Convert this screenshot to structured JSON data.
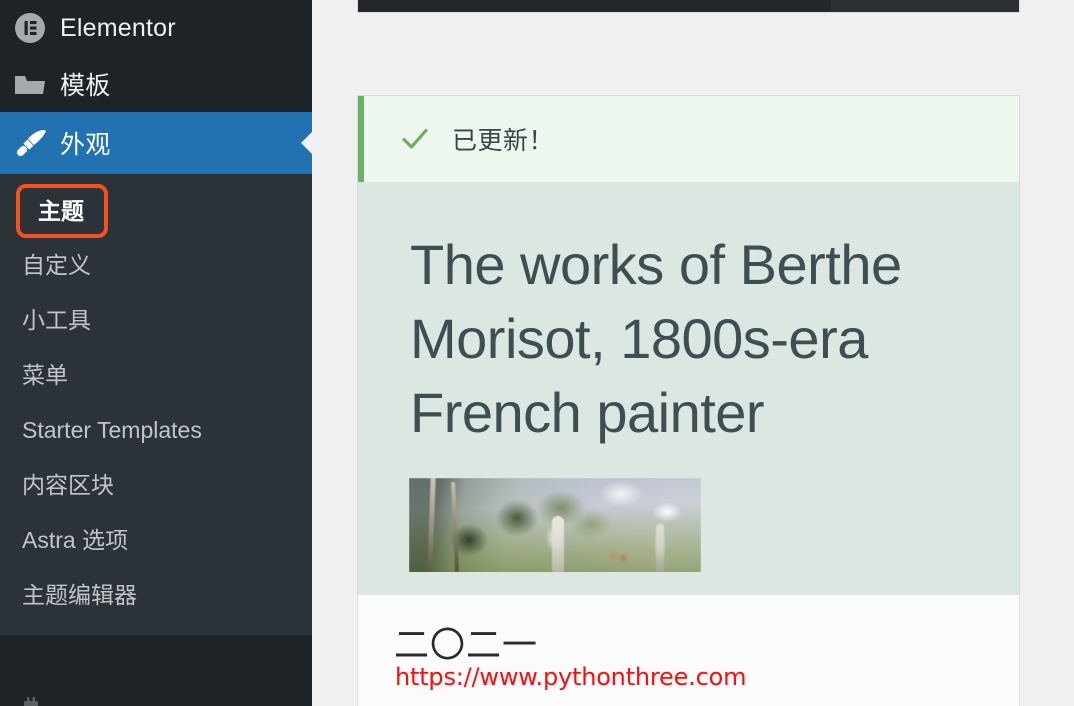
{
  "sidebar": {
    "top_items": [
      {
        "label": "Elementor",
        "icon": "elementor-icon",
        "current": false
      },
      {
        "label": "模板",
        "icon": "folder-icon",
        "current": false
      },
      {
        "label": "外观",
        "icon": "paintbrush-icon",
        "current": true
      }
    ],
    "submenu": [
      {
        "label": "主题",
        "active": true,
        "highlighted": true
      },
      {
        "label": "自定义",
        "active": false,
        "highlighted": false
      },
      {
        "label": "小工具",
        "active": false,
        "highlighted": false
      },
      {
        "label": "菜单",
        "active": false,
        "highlighted": false
      },
      {
        "label": "Starter Templates",
        "active": false,
        "highlighted": false
      },
      {
        "label": "内容区块",
        "active": false,
        "highlighted": false
      },
      {
        "label": "Astra 选项",
        "active": false,
        "highlighted": false
      },
      {
        "label": "主题编辑器",
        "active": false,
        "highlighted": false
      }
    ],
    "footer_icon": "plugin-icon",
    "colors": {
      "background": "#1d2327",
      "submenu_background": "#2c3338",
      "current_highlight": "#2271b1",
      "text": "#f0f0f1",
      "muted_text": "#c3c4c7",
      "annotation_box": "#f4511e"
    }
  },
  "notice": {
    "icon": "check-icon",
    "message": "已更新！",
    "accent_color": "#68b168",
    "background": "#edf7ed"
  },
  "theme_preview": {
    "heading": "The works of Berthe Morisot, 1800s-era French painter",
    "heading_color": "#3d4f52",
    "panel_background": "#dce7e1",
    "image_alt": "berthe-morisot-painting"
  },
  "watermark": {
    "year_cn": "二〇二一",
    "url": "https://www.pythonthree.com",
    "url_color": "#fc0d0d"
  }
}
